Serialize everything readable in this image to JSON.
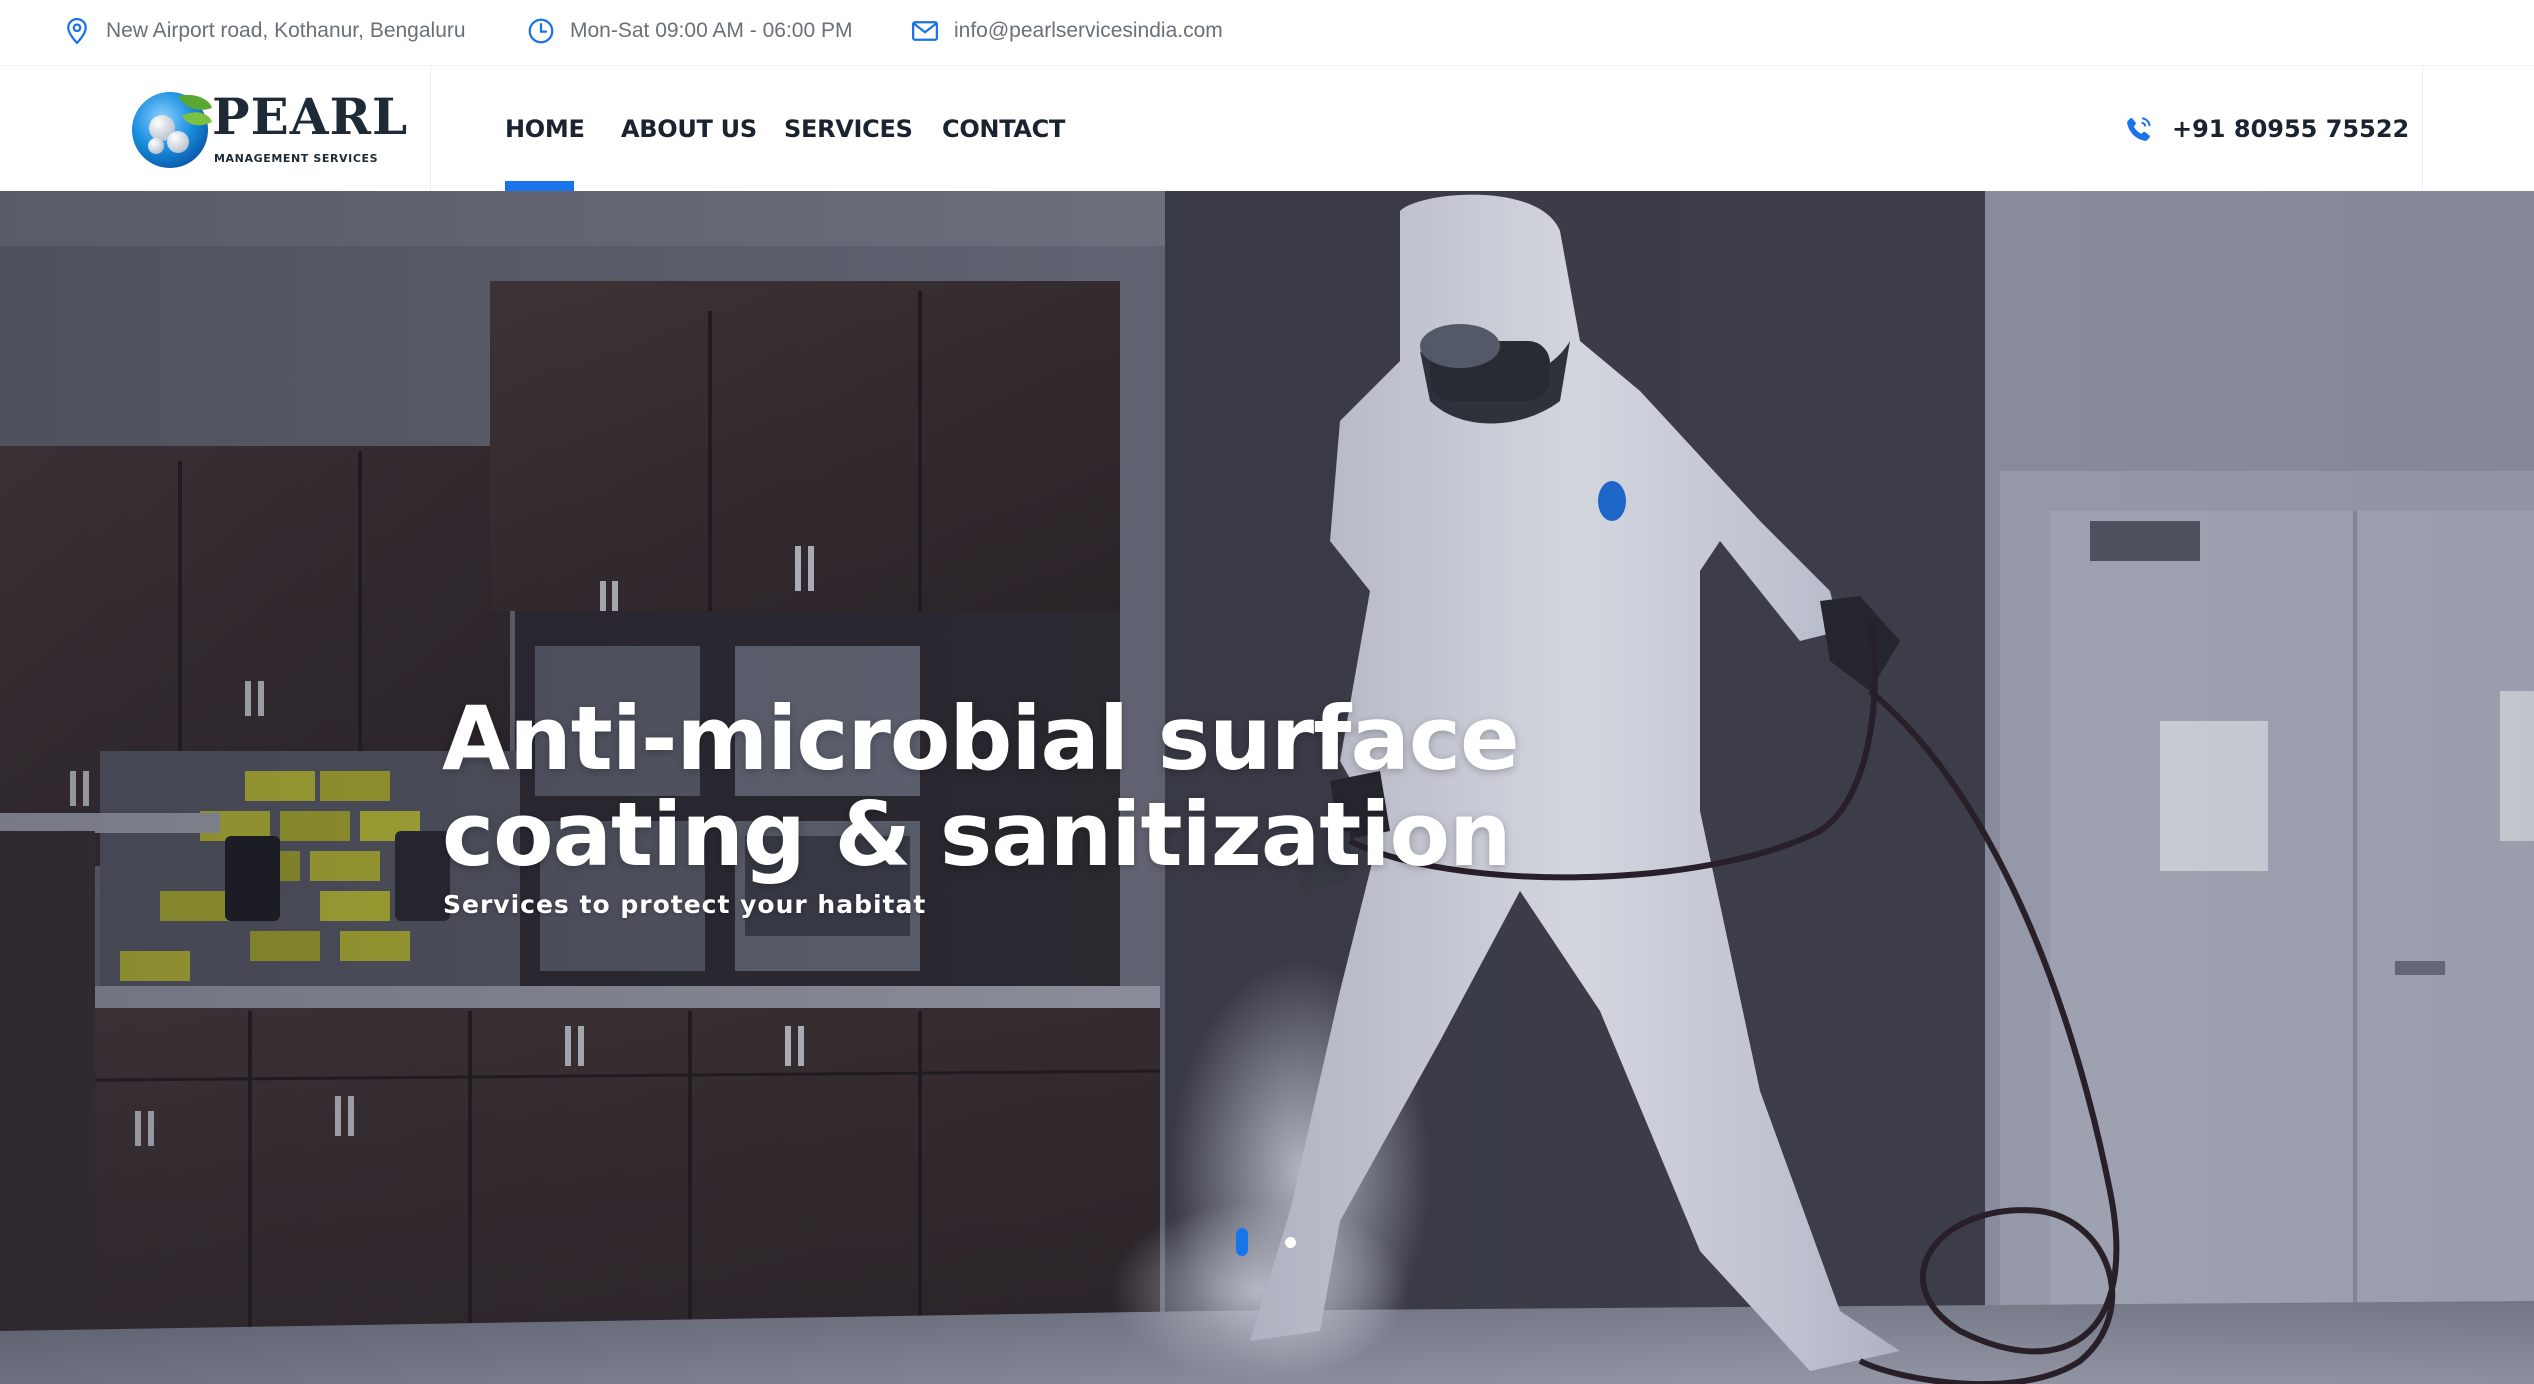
{
  "topbar": {
    "address": "New Airport road, Kothanur, Bengaluru",
    "hours": "Mon-Sat 09:00 AM - 06:00 PM",
    "email": "info@pearlservicesindia.com",
    "icons": [
      "location-pin-icon",
      "clock-icon",
      "mail-icon"
    ]
  },
  "brand": {
    "name": "PEARL",
    "tagline": "MANAGEMENT SERVICES"
  },
  "nav": {
    "items": [
      {
        "label": "HOME",
        "active": true
      },
      {
        "label": "ABOUT US",
        "active": false
      },
      {
        "label": "SERVICES",
        "active": false
      },
      {
        "label": "CONTACT",
        "active": false
      }
    ]
  },
  "header": {
    "phone": "+91 80955 75522",
    "phone_icon": "phone-icon"
  },
  "hero": {
    "title_line1": "Anti-microbial surface",
    "title_line2": "coating & sanitization",
    "subtitle": "Services to protect your habitat",
    "slide_count": 2,
    "active_slide": 1
  },
  "colors": {
    "accent": "#1a73e8",
    "text_dark": "#1b2230",
    "text_muted": "#6b6f78",
    "icon_blue": "#1a73e8"
  }
}
